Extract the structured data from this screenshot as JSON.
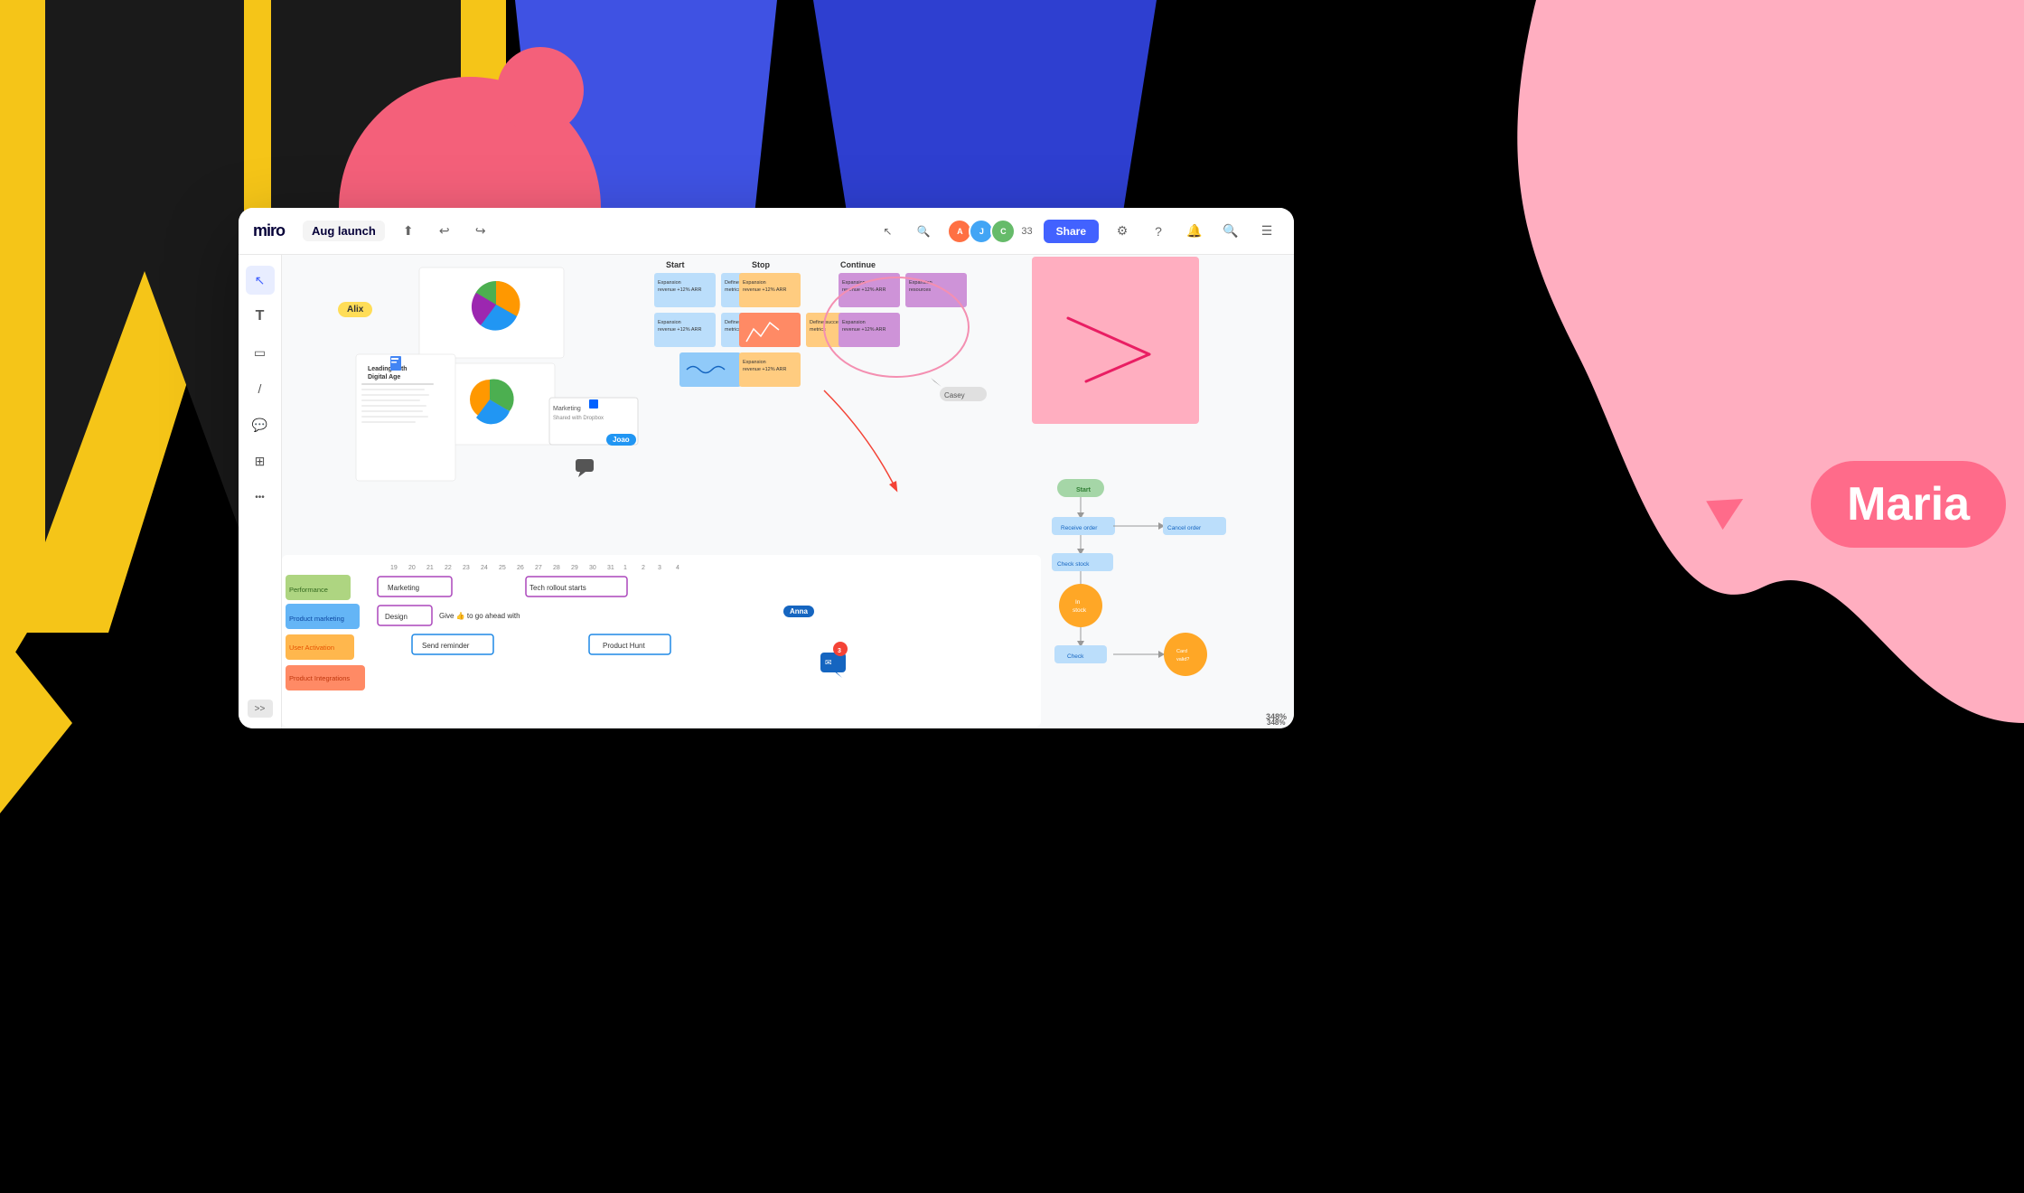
{
  "app": {
    "title": "Miro",
    "board_name": "Aug launch"
  },
  "toolbar": {
    "share_label": "Share",
    "upload_icon": "↑",
    "undo_icon": "↩",
    "redo_icon": "↪",
    "user_count": "33"
  },
  "tools": [
    {
      "name": "select",
      "icon": "↖",
      "active": true
    },
    {
      "name": "text",
      "icon": "T"
    },
    {
      "name": "sticky",
      "icon": "□"
    },
    {
      "name": "pen",
      "icon": "/"
    },
    {
      "name": "comment",
      "icon": "💬"
    },
    {
      "name": "frame",
      "icon": "⊞"
    },
    {
      "name": "more",
      "icon": "•••"
    }
  ],
  "canvas": {
    "zoom": "348%",
    "cursors": [
      {
        "name": "Alix",
        "color": "#FFDD57"
      },
      {
        "name": "Joao",
        "color": "#2196F3"
      },
      {
        "name": "Casey",
        "color": "#bdbdbd"
      },
      {
        "name": "Anna",
        "color": "#1565C0"
      }
    ]
  },
  "retro": {
    "columns": [
      {
        "label": "Start"
      },
      {
        "label": "Stop"
      },
      {
        "label": "Continue"
      }
    ]
  },
  "timeline": {
    "rows": [
      {
        "label": "Performance",
        "color": "#8BC34A"
      },
      {
        "label": "Product marketing",
        "color": "#64B5F6"
      },
      {
        "label": "User Activation",
        "color": "#FFB74D"
      },
      {
        "label": "Product Integrations",
        "color": "#FF8A65"
      }
    ],
    "events": [
      {
        "label": "Marketing",
        "color": "#fff",
        "border": "#9C27B0"
      },
      {
        "label": "Tech rollout starts",
        "color": "#fff",
        "border": "#9C27B0"
      },
      {
        "label": "Design",
        "color": "#fff",
        "border": "#9C27B0"
      },
      {
        "label": "Give 👍 to go ahead with",
        "color": "#fff",
        "border": "none"
      },
      {
        "label": "Send reminder",
        "color": "#fff",
        "border": "#2196F3"
      },
      {
        "label": "Product Hunt",
        "color": "#fff",
        "border": "#2196F3"
      }
    ],
    "date_range": [
      "19",
      "20",
      "21",
      "22",
      "23",
      "24",
      "25",
      "26",
      "27",
      "28",
      "29",
      "30",
      "31",
      "1",
      "2",
      "3",
      "4"
    ]
  },
  "flowchart": {
    "nodes": [
      {
        "label": "Start",
        "type": "green_rounded"
      },
      {
        "label": "Receive order",
        "type": "blue_rounded"
      },
      {
        "label": "Check stock",
        "type": "blue_rounded"
      },
      {
        "label": "In stock",
        "type": "orange_circle"
      },
      {
        "label": "Check",
        "type": "blue_rounded"
      },
      {
        "label": "Card valid?",
        "type": "orange_circle"
      },
      {
        "label": "Cancel order",
        "type": "blue_rounded"
      }
    ]
  },
  "notification": {
    "count": "3"
  },
  "maria_label": "Maria",
  "background": {
    "yellow_color": "#F5C518",
    "blue_color": "#3F52E3",
    "pink_color": "#FFAEC0"
  }
}
